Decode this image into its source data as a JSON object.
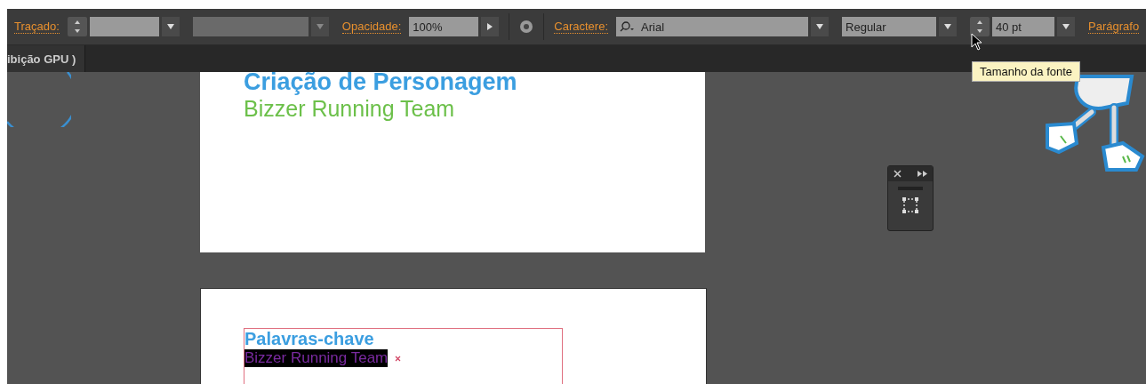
{
  "control_bar": {
    "stroke_label": "Traçado:",
    "opacity_label": "Opacidade:",
    "opacity_value": "100%",
    "character_label": "Caractere:",
    "font_family": "Arial",
    "font_style": "Regular",
    "font_size": "40 pt",
    "paragraph_label": "Parágrafo"
  },
  "tabs": [
    {
      "label": "ibição GPU )"
    }
  ],
  "tooltip": "Tamanho da fonte",
  "artboards": [
    {
      "title": "Criação de Personagem",
      "subtitle": "Bizzer Running Team",
      "subtitle_selected": false
    },
    {
      "title": "Palavras-chave",
      "subtitle": "Bizzer Running Team",
      "subtitle_selected": true
    }
  ]
}
